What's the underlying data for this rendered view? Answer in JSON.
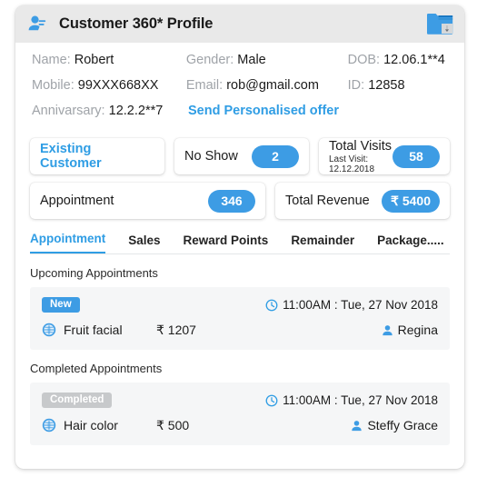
{
  "header": {
    "title": "Customer 360* Profile",
    "avatar_icon": "person-head-icon",
    "export_icon": "folder-download-icon"
  },
  "info": {
    "name_label": "Name:",
    "name_value": "Robert",
    "gender_label": "Gender:",
    "gender_value": "Male",
    "dob_label": "DOB:",
    "dob_value": "12.06.1**4",
    "mobile_label": "Mobile:",
    "mobile_value": "99XXX668XX",
    "email_label": "Email:",
    "email_value": "rob@gmail.com",
    "id_label": "ID:",
    "id_value": "12858",
    "anniversary_label": "Annivarsary:",
    "anniversary_value": "12.2.2**7",
    "offer_link": "Send Personalised offer"
  },
  "stats": {
    "existing_customer": "Existing Customer",
    "no_show_label": "No Show",
    "no_show_value": "2",
    "total_visits_label": "Total Visits",
    "total_visits_sub": "Last Visit: 12.12.2018",
    "total_visits_value": "58",
    "appointment_label": "Appointment",
    "appointment_value": "346",
    "total_revenue_label": "Total Revenue",
    "total_revenue_value": "₹ 5400"
  },
  "tabs": [
    {
      "label": "Appointment",
      "active": true
    },
    {
      "label": "Sales",
      "active": false
    },
    {
      "label": "Reward Points",
      "active": false
    },
    {
      "label": "Remainder",
      "active": false
    },
    {
      "label": "Package.....",
      "active": false
    }
  ],
  "upcoming": {
    "section_title": "Upcoming Appointments",
    "badge": "New",
    "datetime": "11:00AM : Tue, 27 Nov 2018",
    "service": "Fruit facial",
    "price": "₹ 1207",
    "staff": "Regina"
  },
  "completed": {
    "section_title": "Completed Appointments",
    "badge": "Completed",
    "datetime": "11:00AM : Tue, 27 Nov 2018",
    "service": "Hair color",
    "price": "₹ 500",
    "staff": "Steffy Grace"
  },
  "colors": {
    "accent_blue": "#3d9ce4",
    "link_blue": "#2f9de4",
    "header_bg": "#e9e9e9",
    "row_bg": "#f5f6f7",
    "muted_label": "#9fa3a8",
    "badge_gray": "#c7c9cb"
  }
}
